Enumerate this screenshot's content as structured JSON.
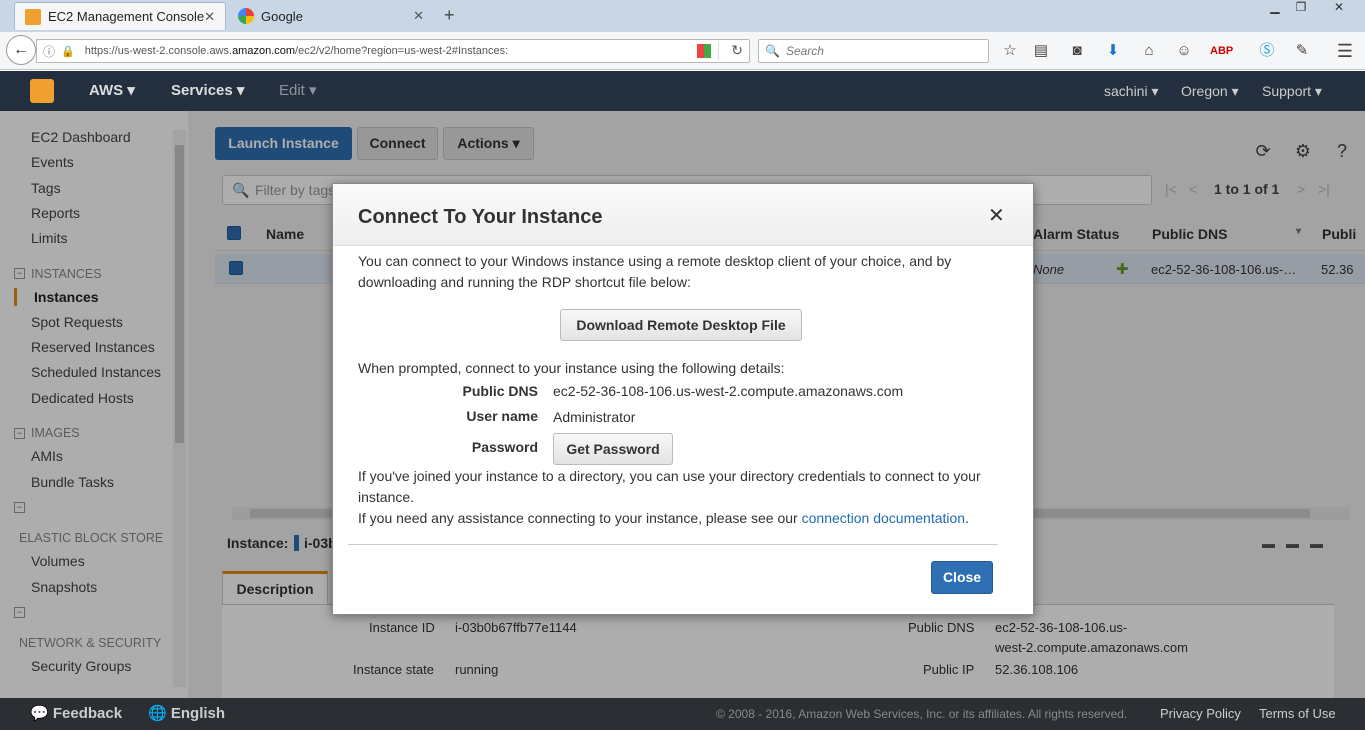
{
  "browser": {
    "tabs": [
      {
        "title": "EC2 Management Console",
        "close": "✕"
      },
      {
        "title": "Google",
        "close": "✕"
      }
    ],
    "new_tab": "+",
    "url": {
      "prefix": "https://us-west-2.console.aws.",
      "domain": "amazon.com",
      "suffix": "/ec2/v2/home?region=us-west-2#Instances:"
    },
    "search_placeholder": "Search"
  },
  "aws_header": {
    "nav": [
      "AWS",
      "Services",
      "Edit"
    ],
    "right": [
      "sachini",
      "Oregon",
      "Support"
    ]
  },
  "sidebar": {
    "items_top": [
      "EC2 Dashboard",
      "Events",
      "Tags",
      "Reports",
      "Limits"
    ],
    "section_instances": "INSTANCES",
    "instances_items": [
      "Instances",
      "Spot Requests",
      "Reserved Instances",
      "Scheduled Instances",
      "Dedicated Hosts"
    ],
    "section_images": "IMAGES",
    "images_items": [
      "AMIs",
      "Bundle Tasks"
    ],
    "section_ebs": "ELASTIC BLOCK STORE",
    "ebs_items": [
      "Volumes",
      "Snapshots"
    ],
    "section_network": "NETWORK & SECURITY",
    "network_items": [
      "Security Groups"
    ]
  },
  "toolbar": {
    "launch": "Launch Instance",
    "connect": "Connect",
    "actions": "Actions"
  },
  "filter": {
    "placeholder": "Filter by tags"
  },
  "pager": "1 to 1 of 1",
  "table": {
    "headers": {
      "name": "Name",
      "alarm": "Alarm Status",
      "dns": "Public DNS",
      "ip": "Publi"
    },
    "row": {
      "alarm": "None",
      "dns": "ec2-52-36-108-106.us-…",
      "ip": "52.36"
    }
  },
  "lower": {
    "instance_label": "Instance:",
    "instance_short": "i-03b",
    "tab_description": "Description",
    "fields": {
      "instance_id_label": "Instance ID",
      "instance_id": "i-03b0b67ffb77e1144",
      "instance_state_label": "Instance state",
      "instance_state": "running",
      "public_dns_label": "Public DNS",
      "public_dns_line1": "ec2-52-36-108-106.us-",
      "public_dns_line2": "west-2.compute.amazonaws.com",
      "public_ip_label": "Public IP",
      "public_ip": "52.36.108.106"
    }
  },
  "modal": {
    "title": "Connect To Your Instance",
    "close_x": "✕",
    "intro_line1": "You can connect to your Windows instance using a remote desktop client of your choice, and by",
    "intro_line2": "downloading and running the RDP shortcut file below:",
    "download_button": "Download Remote Desktop File",
    "prompt": "When prompted, connect to your instance using the following details:",
    "details": {
      "dns_label": "Public DNS",
      "dns_value": "ec2-52-36-108-106.us-west-2.compute.amazonaws.com",
      "user_label": "User name",
      "user_value": "Administrator",
      "password_label": "Password",
      "password_button": "Get Password"
    },
    "dir_line1": "If you've joined your instance to a directory, you can use your directory credentials to connect to your",
    "dir_line2": "instance.",
    "help_text": "If you need any assistance connecting to your instance, please see our ",
    "help_link": "connection documentation",
    "help_end": ".",
    "close_button": "Close"
  },
  "footer": {
    "feedback": "Feedback",
    "language": "English",
    "copyright": "© 2008 - 2016, Amazon Web Services, Inc. or its affiliates. All rights reserved.",
    "privacy": "Privacy Policy",
    "terms": "Terms of Use"
  },
  "colors": {
    "aws_header": "#232f3e",
    "primary_button": "#2f6fb3",
    "accent": "#e88a10",
    "link": "#1f6bb3"
  },
  "icons": [
    "aws-cube-icon",
    "refresh-icon",
    "gear-icon",
    "help-icon",
    "search-icon",
    "close-icon"
  ]
}
